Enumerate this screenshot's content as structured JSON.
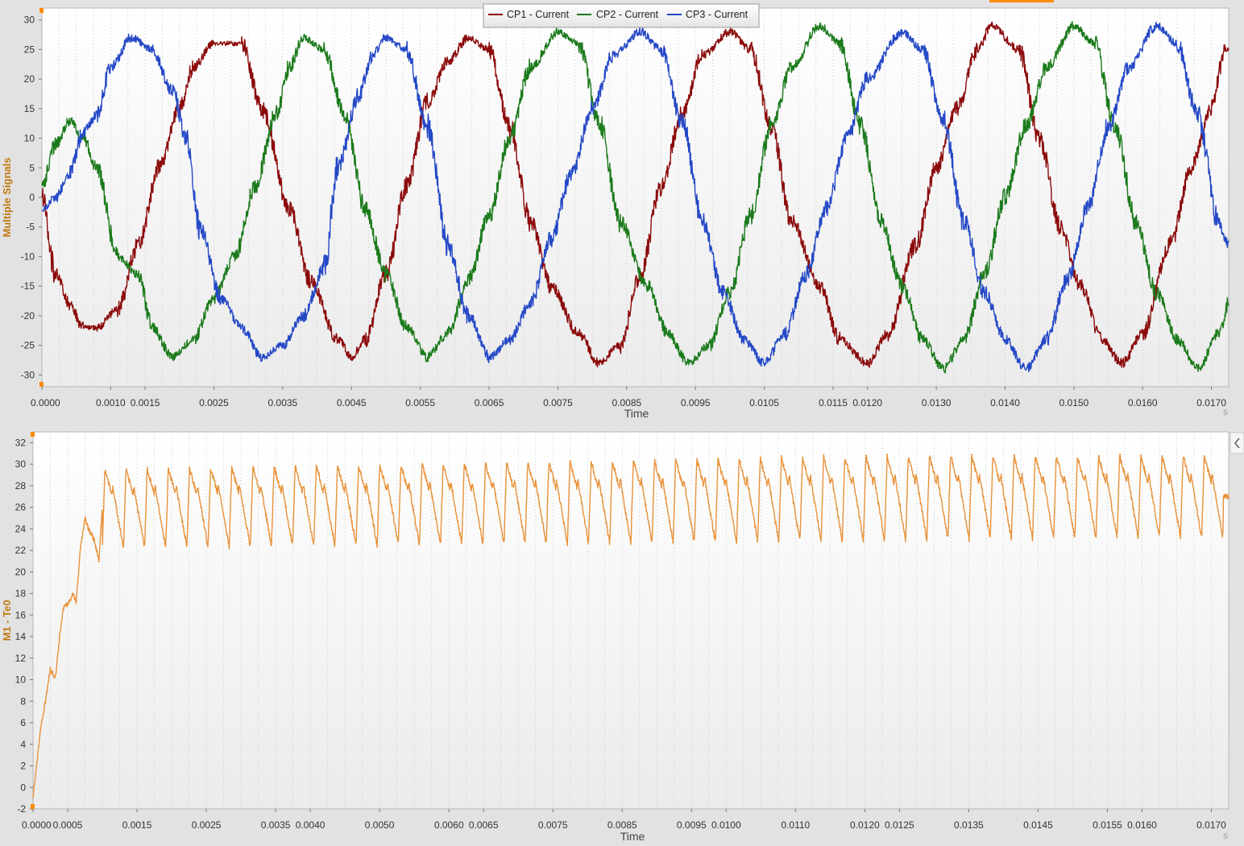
{
  "chart_data": [
    {
      "type": "line",
      "ylabel": "Multiple Signals",
      "xlabel": "Time",
      "x_unit": "s",
      "xlim": [
        0,
        0.01725
      ],
      "ylim": [
        -32,
        32
      ],
      "y_ticks": [
        "30",
        "25",
        "20",
        "15",
        "10",
        "5",
        "0",
        "-5",
        "-10",
        "-15",
        "-20",
        "-25",
        "-30"
      ],
      "x_ticks": [
        "0.0000",
        "0.0010",
        "0.0015",
        "0.0025",
        "0.0035",
        "0.0045",
        "0.0055",
        "0.0065",
        "0.0075",
        "0.0085",
        "0.0095",
        "0.0105",
        "0.0115",
        "0.0120",
        "0.0130",
        "0.0140",
        "0.0150",
        "0.0160",
        "0.0170"
      ],
      "legend_placement": "top-center",
      "grid": true,
      "series": [
        {
          "name": "CP1 - Current",
          "color": "#8b0a0a",
          "points": [
            [
              0,
              0
            ],
            [
              0.0002,
              -13
            ],
            [
              0.0004,
              -18
            ],
            [
              0.0006,
              -22
            ],
            [
              0.0008,
              -22
            ],
            [
              0.0011,
              -19
            ],
            [
              0.0014,
              -8
            ],
            [
              0.0017,
              5
            ],
            [
              0.002,
              15
            ],
            [
              0.0022,
              22
            ],
            [
              0.0025,
              26
            ],
            [
              0.0029,
              26
            ],
            [
              0.0032,
              15
            ],
            [
              0.0036,
              -2
            ],
            [
              0.0039,
              -14
            ],
            [
              0.0043,
              -24
            ],
            [
              0.0045,
              -27
            ],
            [
              0.0047,
              -24
            ],
            [
              0.005,
              -13
            ],
            [
              0.0053,
              2
            ],
            [
              0.0056,
              16
            ],
            [
              0.0059,
              23
            ],
            [
              0.0062,
              27
            ],
            [
              0.0065,
              25
            ],
            [
              0.0068,
              12
            ],
            [
              0.0071,
              -4
            ],
            [
              0.0074,
              -15
            ],
            [
              0.0078,
              -23
            ],
            [
              0.0081,
              -28
            ],
            [
              0.0084,
              -25
            ],
            [
              0.0087,
              -13
            ],
            [
              0.009,
              2
            ],
            [
              0.0093,
              14
            ],
            [
              0.0096,
              24
            ],
            [
              0.01,
              28
            ],
            [
              0.0103,
              25
            ],
            [
              0.0106,
              12
            ],
            [
              0.0109,
              -4
            ],
            [
              0.0113,
              -15
            ],
            [
              0.0116,
              -24
            ],
            [
              0.012,
              -28
            ],
            [
              0.0123,
              -23
            ],
            [
              0.0127,
              -8
            ],
            [
              0.013,
              5
            ],
            [
              0.0133,
              15
            ],
            [
              0.0136,
              25
            ],
            [
              0.0138,
              29
            ],
            [
              0.0142,
              25
            ],
            [
              0.0145,
              10
            ],
            [
              0.0148,
              -5
            ],
            [
              0.0151,
              -15
            ],
            [
              0.0154,
              -24
            ],
            [
              0.0157,
              -28
            ],
            [
              0.016,
              -23
            ],
            [
              0.0164,
              -8
            ],
            [
              0.0167,
              5
            ],
            [
              0.017,
              15
            ],
            [
              0.0172,
              25
            ],
            [
              0.01725,
              25
            ]
          ]
        },
        {
          "name": "CP2 - Current",
          "color": "#1b7a1b",
          "points": [
            [
              0,
              2
            ],
            [
              0.0002,
              9
            ],
            [
              0.0004,
              13
            ],
            [
              0.0006,
              10
            ],
            [
              0.0008,
              5
            ],
            [
              0.0011,
              -10
            ],
            [
              0.0014,
              -13
            ],
            [
              0.0016,
              -22
            ],
            [
              0.0019,
              -27
            ],
            [
              0.0022,
              -24
            ],
            [
              0.0025,
              -17
            ],
            [
              0.0028,
              -10
            ],
            [
              0.0031,
              2
            ],
            [
              0.0034,
              14
            ],
            [
              0.0036,
              22
            ],
            [
              0.0038,
              27
            ],
            [
              0.0041,
              25
            ],
            [
              0.0044,
              14
            ],
            [
              0.0047,
              -2
            ],
            [
              0.005,
              -13
            ],
            [
              0.0053,
              -22
            ],
            [
              0.0056,
              -27
            ],
            [
              0.0059,
              -23
            ],
            [
              0.0062,
              -14
            ],
            [
              0.0065,
              -3
            ],
            [
              0.0068,
              10
            ],
            [
              0.0071,
              22
            ],
            [
              0.0075,
              28
            ],
            [
              0.0078,
              26
            ],
            [
              0.0081,
              13
            ],
            [
              0.0084,
              -4
            ],
            [
              0.0088,
              -15
            ],
            [
              0.0091,
              -23
            ],
            [
              0.0094,
              -28
            ],
            [
              0.0097,
              -25
            ],
            [
              0.01,
              -16
            ],
            [
              0.0103,
              -3
            ],
            [
              0.0106,
              12
            ],
            [
              0.0109,
              22
            ],
            [
              0.0113,
              29
            ],
            [
              0.0116,
              26
            ],
            [
              0.0119,
              12
            ],
            [
              0.0122,
              -4
            ],
            [
              0.0125,
              -15
            ],
            [
              0.0128,
              -24
            ],
            [
              0.0131,
              -29
            ],
            [
              0.0134,
              -24
            ],
            [
              0.0137,
              -13
            ],
            [
              0.014,
              0
            ],
            [
              0.0143,
              12
            ],
            [
              0.0146,
              22
            ],
            [
              0.015,
              29
            ],
            [
              0.0153,
              26
            ],
            [
              0.0156,
              12
            ],
            [
              0.0159,
              -4
            ],
            [
              0.0162,
              -16
            ],
            [
              0.0165,
              -24
            ],
            [
              0.0168,
              -29
            ],
            [
              0.0171,
              -23
            ],
            [
              0.01725,
              -18
            ]
          ]
        },
        {
          "name": "CP3 - Current",
          "color": "#2448c6",
          "points": [
            [
              0,
              -2
            ],
            [
              0.0002,
              0
            ],
            [
              0.0004,
              4
            ],
            [
              0.0006,
              11
            ],
            [
              0.0008,
              14
            ],
            [
              0.001,
              22
            ],
            [
              0.0013,
              27
            ],
            [
              0.0016,
              25
            ],
            [
              0.0019,
              18
            ],
            [
              0.0021,
              10
            ],
            [
              0.0023,
              -5
            ],
            [
              0.0026,
              -17
            ],
            [
              0.0029,
              -22
            ],
            [
              0.0032,
              -27
            ],
            [
              0.0035,
              -25
            ],
            [
              0.0038,
              -20
            ],
            [
              0.0041,
              -12
            ],
            [
              0.0043,
              5
            ],
            [
              0.0046,
              17
            ],
            [
              0.0048,
              24
            ],
            [
              0.005,
              27
            ],
            [
              0.0053,
              25
            ],
            [
              0.0056,
              12
            ],
            [
              0.0059,
              -8
            ],
            [
              0.0062,
              -20
            ],
            [
              0.0065,
              -27
            ],
            [
              0.0068,
              -24
            ],
            [
              0.0071,
              -18
            ],
            [
              0.0074,
              -7
            ],
            [
              0.0077,
              4
            ],
            [
              0.008,
              15
            ],
            [
              0.0083,
              24
            ],
            [
              0.0087,
              28
            ],
            [
              0.009,
              25
            ],
            [
              0.0093,
              13
            ],
            [
              0.0096,
              -4
            ],
            [
              0.0099,
              -16
            ],
            [
              0.0102,
              -24
            ],
            [
              0.0105,
              -28
            ],
            [
              0.0108,
              -23
            ],
            [
              0.0111,
              -13
            ],
            [
              0.0114,
              -2
            ],
            [
              0.0117,
              10
            ],
            [
              0.012,
              20
            ],
            [
              0.0125,
              28
            ],
            [
              0.0128,
              25
            ],
            [
              0.0131,
              13
            ],
            [
              0.0134,
              -4
            ],
            [
              0.0137,
              -16
            ],
            [
              0.014,
              -24
            ],
            [
              0.0143,
              -29
            ],
            [
              0.0146,
              -24
            ],
            [
              0.0149,
              -14
            ],
            [
              0.0152,
              -2
            ],
            [
              0.0155,
              12
            ],
            [
              0.0158,
              22
            ],
            [
              0.0162,
              29
            ],
            [
              0.0165,
              26
            ],
            [
              0.0168,
              14
            ],
            [
              0.0171,
              -4
            ],
            [
              0.01725,
              -8
            ]
          ]
        }
      ]
    },
    {
      "type": "line",
      "ylabel": "M1 - Te0",
      "xlabel": "Time",
      "x_unit": "s",
      "xlim": [
        0,
        0.01725
      ],
      "ylim": [
        -2,
        33
      ],
      "y_ticks": [
        "32",
        "30",
        "28",
        "26",
        "24",
        "22",
        "20",
        "18",
        "16",
        "14",
        "12",
        "10",
        "8",
        "6",
        "4",
        "2",
        "0",
        "-2"
      ],
      "x_ticks": [
        "0.0000",
        "0.0005",
        "0.0015",
        "0.0025",
        "0.0035",
        "0.0040",
        "0.0050",
        "0.0060",
        "0.0065",
        "0.0075",
        "0.0085",
        "0.0095",
        "0.0100",
        "0.0110",
        "0.0120",
        "0.0125",
        "0.0135",
        "0.0145",
        "0.0155",
        "0.0160",
        "0.0170"
      ],
      "grid": true,
      "series": [
        {
          "color": "#e8923a",
          "startup": [
            [
              0,
              -1
            ],
            [
              5e-05,
              2
            ],
            [
              0.0001,
              5
            ],
            [
              0.00018,
              8
            ],
            [
              0.00025,
              11
            ],
            [
              0.00032,
              10
            ],
            [
              0.0004,
              15
            ],
            [
              0.00045,
              17
            ],
            [
              0.0005,
              17
            ],
            [
              0.00058,
              18
            ],
            [
              0.00062,
              17
            ],
            [
              0.00068,
              22
            ],
            [
              0.00075,
              25
            ],
            [
              0.0008,
              24
            ],
            [
              0.00088,
              23
            ],
            [
              0.00095,
              21
            ],
            [
              0.001,
              26
            ]
          ],
          "ripple_start": 0.001,
          "ripple_period": 0.000305,
          "ripple_peak_start": 29.5,
          "ripple_peak_end": 30.8,
          "ripple_trough_start": 22.2,
          "ripple_trough_end": 23.2,
          "end_value": 27
        }
      ]
    }
  ]
}
